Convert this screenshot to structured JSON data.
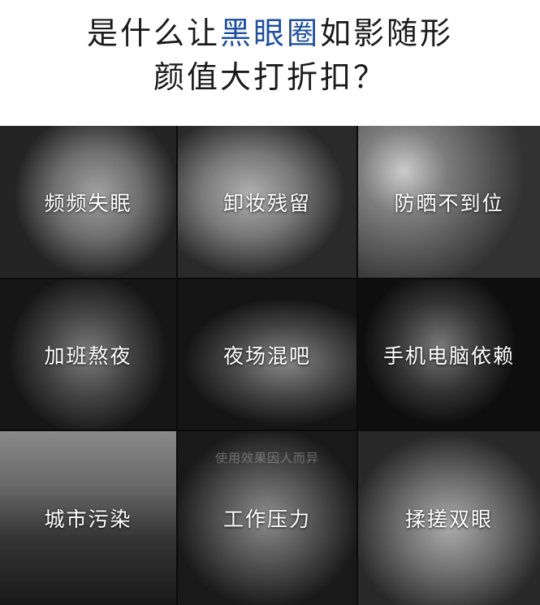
{
  "headline": {
    "line1_prefix": "是什么让",
    "line1_accent": "黑眼圈",
    "line1_suffix": "如影随形",
    "line2": "颜值大打折扣？",
    "accent_color": "#1d4fa3"
  },
  "tiles": [
    {
      "caption": "频频失眠"
    },
    {
      "caption": "卸妆残留"
    },
    {
      "caption": "防晒不到位"
    },
    {
      "caption": "加班熬夜"
    },
    {
      "caption": "夜场混吧"
    },
    {
      "caption": "手机电脑依赖"
    },
    {
      "caption": "城市污染"
    },
    {
      "caption": "工作压力",
      "watermark": "使用效果因人而异"
    },
    {
      "caption": "揉搓双眼"
    }
  ]
}
